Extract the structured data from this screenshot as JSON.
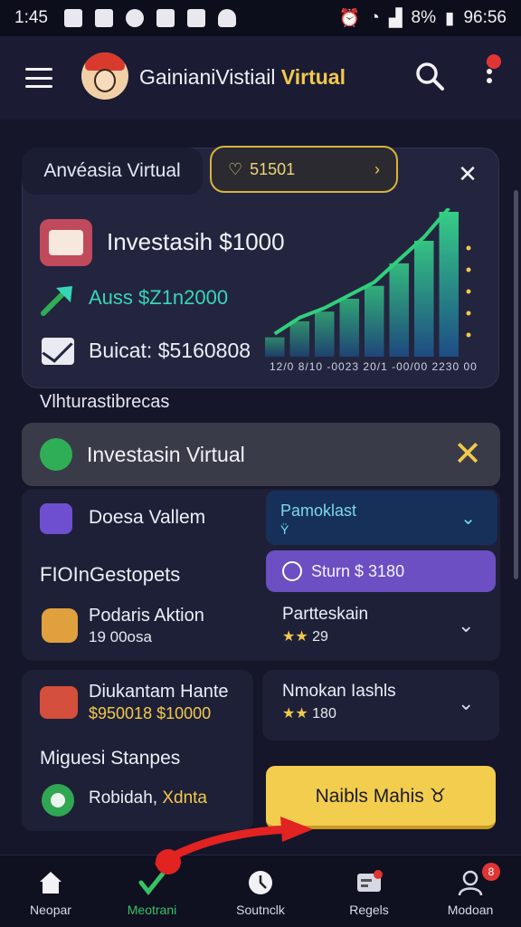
{
  "status_bar": {
    "time": "1:45",
    "battery": "8%",
    "clock_right": "96:56"
  },
  "app_bar": {
    "title_main": "GainianiVistiail",
    "title_accent": "Virtual",
    "notification_count": ""
  },
  "hero": {
    "tab_label": "Anvéasia Virtual",
    "gold_pill": "51501",
    "title": "Investasih $1000",
    "gain_text": "Auss $Z1n2000",
    "balance_text": "Buicat: $5160808",
    "chart_axis_text": "12/0 8/10 -0023 20/1 -00/00 2230 00"
  },
  "chart_data": {
    "type": "bar",
    "values": [
      12,
      22,
      28,
      36,
      44,
      58,
      72,
      90
    ]
  },
  "section_title_1": "Vlhturastibrecas",
  "banner": {
    "label": "Investasin Virtual"
  },
  "wallet_label": "Doesa Vallem",
  "section_title_2": "FIOInGestopets",
  "task": {
    "title": "Podaris Aktion",
    "subtitle": "19 00osa"
  },
  "card_promo": {
    "title": "Pamoklast",
    "subtitle": "Ϋ"
  },
  "card_start": {
    "label": "Sturn $ 3180"
  },
  "card_partner": {
    "title": "Partteskain",
    "stars": "★★",
    "value": "29"
  },
  "reward": {
    "title": "Diukantam Hante",
    "subtitle": "$950018 $10000"
  },
  "card_nokan": {
    "title": "Nmokan Iashls",
    "stars": "★★",
    "value": "180"
  },
  "section_title_3": "Miguesi Stanpes",
  "smile": {
    "label": "Robidah, ",
    "highlight": "Xdnta"
  },
  "cta_label": "Naibls Mahis ♉",
  "nav": [
    {
      "label": "Neopar",
      "icon": "home-icon"
    },
    {
      "label": "Meotrani",
      "icon": "check-icon"
    },
    {
      "label": "Soutnclk",
      "icon": "clock-icon"
    },
    {
      "label": "Regels",
      "icon": "card-icon"
    },
    {
      "label": "Modoan",
      "icon": "user-icon"
    }
  ],
  "nav_badge": "8",
  "colors": {
    "accent_gold": "#f2c94c",
    "teal": "#37d6b7",
    "purple": "#6c4fc2",
    "navy": "#16305a",
    "green": "#37c266"
  }
}
